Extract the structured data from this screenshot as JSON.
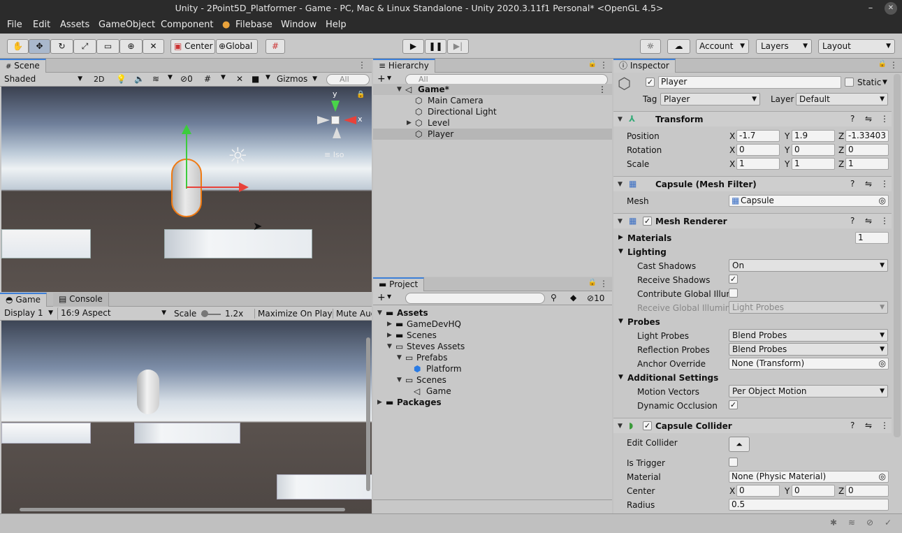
{
  "window": {
    "title": "Unity - 2Point5D_Platformer - Game - PC, Mac & Linux Standalone - Unity 2020.3.11f1 Personal* <OpenGL 4.5>",
    "minimize": "–",
    "close": "✕"
  },
  "menu": [
    "File",
    "Edit",
    "Assets",
    "GameObject",
    "Component",
    "Filebase",
    "Window",
    "Help"
  ],
  "toolbar": {
    "pivot": "Center",
    "space": "Global",
    "account": "Account",
    "layers": "Layers",
    "layout": "Layout"
  },
  "scene": {
    "tab": "Scene",
    "shading": "Shaded",
    "mode2d": "2D",
    "hidden_count": "0",
    "gizmos": "Gizmos",
    "search_placeholder": "All",
    "axis_y": "y",
    "axis_x": "x",
    "projection": "Iso"
  },
  "game": {
    "tab": "Game",
    "console_tab": "Console",
    "display": "Display 1",
    "aspect": "16:9 Aspect",
    "scale_label": "Scale",
    "scale_value": "1.2x",
    "maximize": "Maximize On Play",
    "mute": "Mute Audio"
  },
  "hierarchy": {
    "title": "Hierarchy",
    "search_placeholder": "All",
    "scene": "Game*",
    "items": [
      "Main Camera",
      "Directional Light",
      "Level",
      "Player"
    ]
  },
  "project": {
    "title": "Project",
    "count": "10",
    "tree": [
      {
        "label": "Assets",
        "bold": true
      },
      {
        "label": "GameDevHQ"
      },
      {
        "label": "Scenes"
      },
      {
        "label": "Steves Assets"
      },
      {
        "label": "Prefabs"
      },
      {
        "label": "Platform"
      },
      {
        "label": "Scenes"
      },
      {
        "label": "Game"
      },
      {
        "label": "Packages",
        "bold": true
      }
    ]
  },
  "inspector": {
    "title": "Inspector",
    "name": "Player",
    "static": "Static",
    "tag_label": "Tag",
    "tag": "Player",
    "layer_label": "Layer",
    "layer": "Default",
    "transform": {
      "title": "Transform",
      "position_label": "Position",
      "rotation_label": "Rotation",
      "scale_label": "Scale",
      "px": "-1.7",
      "py": "1.9",
      "pz": "-1.33403",
      "rx": "0",
      "ry": "0",
      "rz": "0",
      "sx": "1",
      "sy": "1",
      "sz": "1",
      "axis_x": "X",
      "axis_y": "Y",
      "axis_z": "Z"
    },
    "mesh_filter": {
      "title": "Capsule (Mesh Filter)",
      "mesh_label": "Mesh",
      "mesh": "Capsule"
    },
    "mesh_renderer": {
      "title": "Mesh Renderer",
      "materials_label": "Materials",
      "materials_count": "1",
      "lighting": "Lighting",
      "cast_shadows_label": "Cast Shadows",
      "cast_shadows": "On",
      "receive_shadows_label": "Receive Shadows",
      "contribute_gi_label": "Contribute Global Illumi",
      "receive_gi_label": "Receive Global Illumina",
      "receive_gi": "Light Probes",
      "probes": "Probes",
      "light_probes_label": "Light Probes",
      "light_probes": "Blend Probes",
      "reflection_probes_label": "Reflection Probes",
      "reflection_probes": "Blend Probes",
      "anchor_label": "Anchor Override",
      "anchor": "None (Transform)",
      "additional": "Additional Settings",
      "motion_label": "Motion Vectors",
      "motion": "Per Object Motion",
      "dynamic_label": "Dynamic Occlusion"
    },
    "capsule_collider": {
      "title": "Capsule Collider",
      "edit_label": "Edit Collider",
      "trigger_label": "Is Trigger",
      "material_label": "Material",
      "material": "None (Physic Material)",
      "center_label": "Center",
      "cx": "0",
      "cy": "0",
      "cz": "0",
      "radius_label": "Radius",
      "radius": "0.5"
    }
  },
  "colors": {
    "title_bg": "#2b2b2b",
    "panel": "#c8c8c8",
    "accent": "#3c7fd8",
    "selection": "#b6b6b6"
  }
}
